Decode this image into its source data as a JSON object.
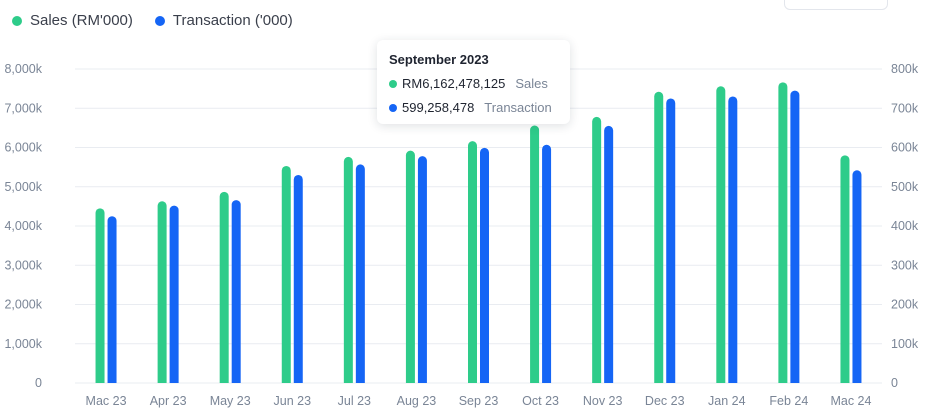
{
  "legend": [
    {
      "label": "Sales (RM'000)",
      "color": "#2ecc8a"
    },
    {
      "label": "Transaction ('000)",
      "color": "#1565f5"
    }
  ],
  "tooltip": {
    "title": "September 2023",
    "rows": [
      {
        "value": "RM6,162,478,125",
        "label": "Sales",
        "color": "#2ecc8a"
      },
      {
        "value": "599,258,478",
        "label": "Transaction",
        "color": "#1565f5"
      }
    ]
  },
  "chart_data": {
    "type": "bar",
    "categories": [
      "Mac 23",
      "Apr 23",
      "May 23",
      "Jun 23",
      "Jul 23",
      "Aug 23",
      "Sep 23",
      "Oct 23",
      "Nov 23",
      "Dec 23",
      "Jan 24",
      "Feb 24",
      "Mac 24"
    ],
    "series": [
      {
        "name": "Sales (RM'000)",
        "axis": "left",
        "color": "#2ecc8a",
        "values": [
          4450,
          4630,
          4870,
          5530,
          5760,
          5920,
          6162,
          6560,
          6780,
          7420,
          7560,
          7660,
          5800
        ]
      },
      {
        "name": "Transaction ('000)",
        "axis": "right",
        "color": "#1565f5",
        "values": [
          425,
          452,
          466,
          530,
          557,
          578,
          599,
          607,
          655,
          725,
          730,
          745,
          542
        ]
      }
    ],
    "y_left": {
      "ylim": [
        0,
        8000
      ],
      "ticks": [
        "0",
        "1,000k",
        "2,000k",
        "3,000k",
        "4,000k",
        "5,000k",
        "6,000k",
        "7,000k",
        "8,000k"
      ]
    },
    "y_right": {
      "ylim": [
        0,
        800
      ],
      "ticks": [
        "0",
        "100k",
        "200k",
        "300k",
        "400k",
        "500k",
        "600k",
        "700k",
        "800k"
      ]
    },
    "grid": true,
    "legend_position": "top-left"
  }
}
